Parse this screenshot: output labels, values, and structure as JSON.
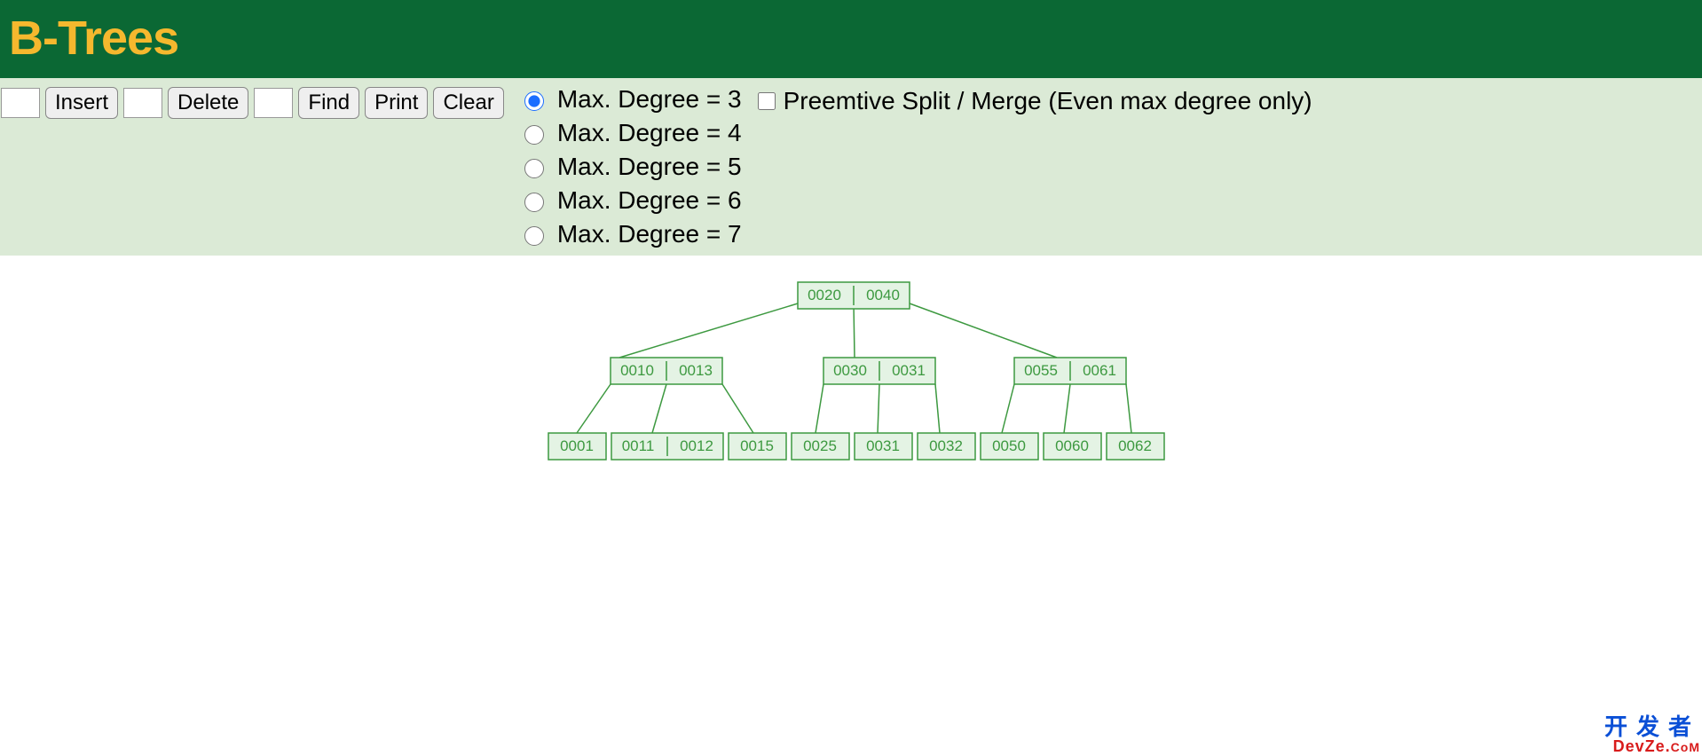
{
  "header": {
    "title": "B-Trees"
  },
  "controls": {
    "insert_value": "",
    "insert_label": "Insert",
    "delete_value": "",
    "delete_label": "Delete",
    "find_value": "",
    "find_label": "Find",
    "print_label": "Print",
    "clear_label": "Clear"
  },
  "degree_options": [
    {
      "label": "Max. Degree = 3",
      "value": 3,
      "selected": true
    },
    {
      "label": "Max. Degree = 4",
      "value": 4,
      "selected": false
    },
    {
      "label": "Max. Degree = 5",
      "value": 5,
      "selected": false
    },
    {
      "label": "Max. Degree = 6",
      "value": 6,
      "selected": false
    },
    {
      "label": "Max. Degree = 7",
      "value": 7,
      "selected": false
    }
  ],
  "preemptive": {
    "label": "Preemtive Split / Merge (Even max degree only)",
    "checked": false
  },
  "tree": {
    "root": {
      "keys": [
        "0020",
        "0040"
      ]
    },
    "level1": [
      {
        "keys": [
          "0010",
          "0013"
        ]
      },
      {
        "keys": [
          "0030",
          "0031"
        ]
      },
      {
        "keys": [
          "0055",
          "0061"
        ]
      }
    ],
    "leaves": [
      {
        "keys": [
          "0001"
        ]
      },
      {
        "keys": [
          "0011",
          "0012"
        ]
      },
      {
        "keys": [
          "0015"
        ]
      },
      {
        "keys": [
          "0025"
        ]
      },
      {
        "keys": [
          "0031"
        ]
      },
      {
        "keys": [
          "0032"
        ]
      },
      {
        "keys": [
          "0050"
        ]
      },
      {
        "keys": [
          "0060"
        ]
      },
      {
        "keys": [
          "0062"
        ]
      }
    ]
  },
  "watermark": {
    "line1": "开发者",
    "line2_a": "DevZe.",
    "line2_b": "CoM"
  }
}
